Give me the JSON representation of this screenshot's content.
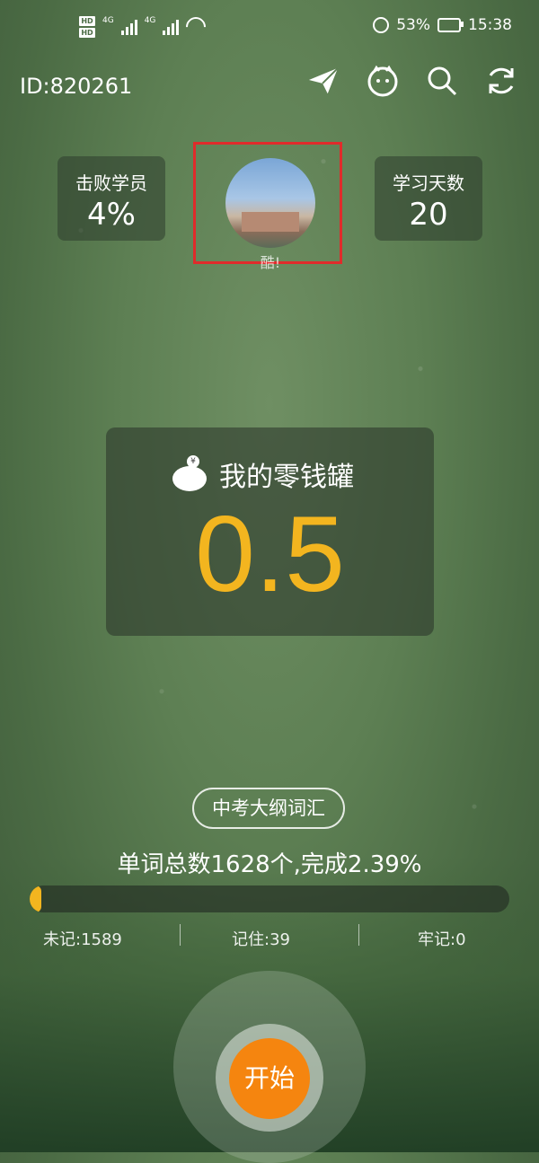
{
  "status_bar": {
    "hd1": "HD",
    "hd2": "HD",
    "net1": "4G",
    "net2": "4G",
    "battery_percent": "53%",
    "time": "15:38"
  },
  "header": {
    "user_id": "ID:820261",
    "icons": [
      "send-icon",
      "mascot-icon",
      "search-icon",
      "refresh-icon"
    ]
  },
  "stats": {
    "defeated_label": "击败学员",
    "defeated_value": "4%",
    "study_days_label": "学习天数",
    "study_days_value": "20"
  },
  "profile": {
    "caption": "酷!"
  },
  "piggy_bank": {
    "title": "我的零钱罐",
    "coin_symbol": "¥",
    "value": "0.5"
  },
  "word_book": {
    "name": "中考大纲词汇",
    "summary": "单词总数1628个,完成2.39%",
    "progress_fraction": 0.0239,
    "unmemorized": "未记:1589",
    "memorized": "记住:39",
    "mastered": "牢记:0"
  },
  "start_button": {
    "label": "开始"
  },
  "colors": {
    "accent_yellow": "#f3b51f",
    "start_orange": "#f5850f",
    "highlight_red": "#e02b2b"
  }
}
